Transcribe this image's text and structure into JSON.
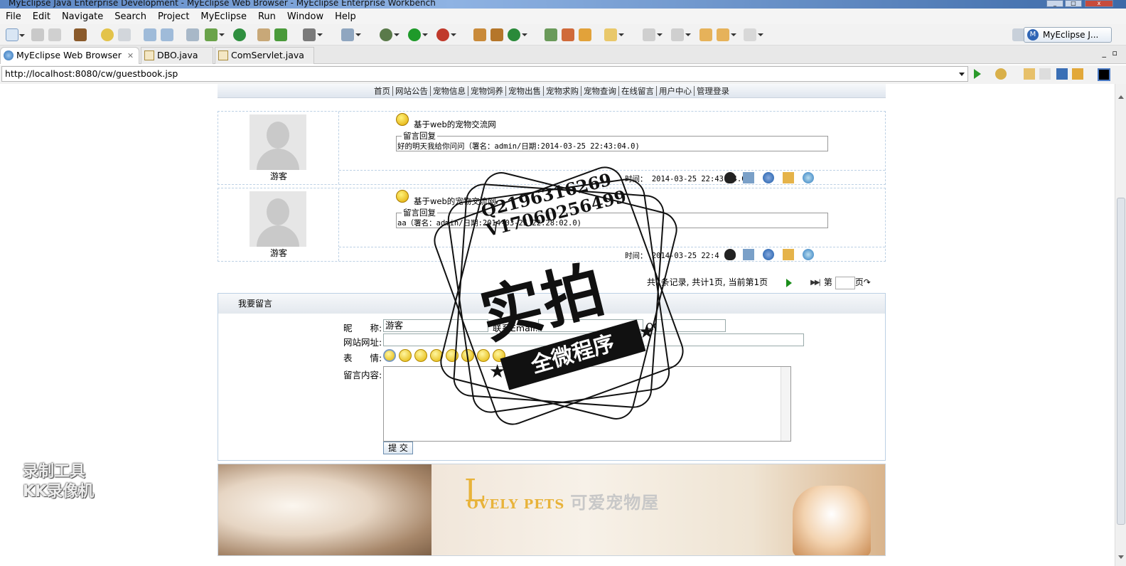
{
  "window": {
    "title": "MyEclipse Java Enterprise Development - MyEclipse Web Browser - MyEclipse Enterprise Workbench"
  },
  "menu": [
    "File",
    "Edit",
    "Navigate",
    "Search",
    "Project",
    "MyEclipse",
    "Run",
    "Window",
    "Help"
  ],
  "perspective": {
    "label": "MyEclipse J..."
  },
  "tabs": [
    {
      "label": "MyEclipse Web Browser",
      "active": true
    },
    {
      "label": "DBO.java"
    },
    {
      "label": "ComServlet.java"
    }
  ],
  "browser": {
    "url": "http://localhost:8080/cw/guestbook.jsp"
  },
  "nav": [
    "首页",
    "网站公告",
    "宠物信息",
    "宠物饲养",
    "宠物出售",
    "宠物求购",
    "宠物查询",
    "在线留言",
    "用户中心",
    "管理登录"
  ],
  "messages": [
    {
      "nick": "游客",
      "title": "基于web的宠物交流网",
      "legend": "留言回复",
      "content": "好的明天我给你问问（署名：admin/日期:2014-03-25 22:43:04.0)",
      "time": "时间： 2014-03-25 22:43:04.0"
    },
    {
      "nick": "游客",
      "title": "基于web的宠物交流网",
      "legend": "留言回复",
      "content": "aa（署名：admin/日期:2014-03-25 22:28:02.0)",
      "time": "时间： 2014-03-25 22:4"
    }
  ],
  "pager": {
    "text": "共2条记录, 共计1页, 当前第1页",
    "page_label": "第",
    "page_suffix": "页"
  },
  "form": {
    "header": "我要留言",
    "nick_label": "昵　　称:",
    "nick_value": "游客",
    "contact_label": "联系Email:",
    "qq_label": "QQ:",
    "site_label": "网站网址:",
    "face_label": "表　　情:",
    "content_label": "留言内容:",
    "submit": "提 交"
  },
  "banner": {
    "brand": "OVELY PETS",
    "cn": "可爱宠物屋"
  },
  "watermark": {
    "line1": "录制工具",
    "line2": "KK录像机"
  },
  "stamp": {
    "q": "Q2196316269",
    "v": "V17060256499",
    "big": "实拍",
    "ribbon": "全微程序"
  }
}
